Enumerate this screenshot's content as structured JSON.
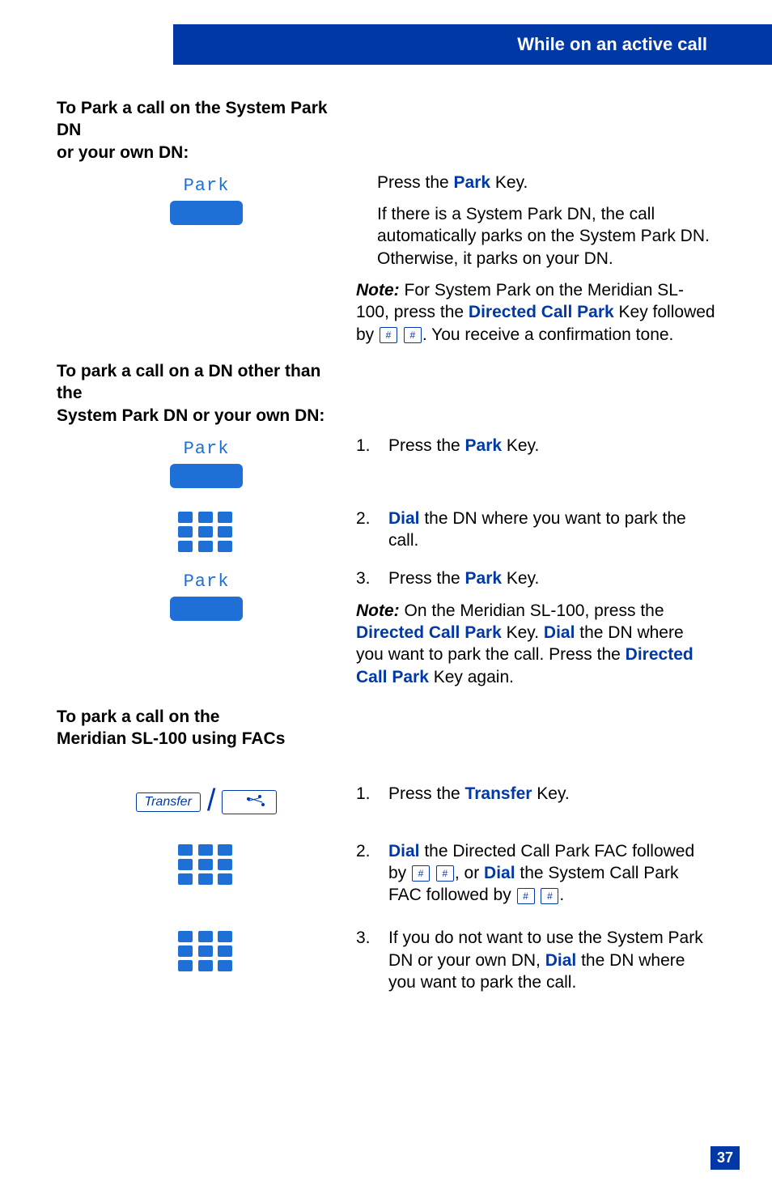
{
  "header": {
    "title": "While on an active call"
  },
  "section1": {
    "heading_line1": "To Park a call on the System Park DN",
    "heading_line2": "or your own DN:",
    "softkey_label": "Park",
    "para1_a": "Press the ",
    "para1_key": "Park",
    "para1_b": " Key.",
    "para2": "If there is a System Park DN, the call automatically parks on the System Park DN. Otherwise, it parks on your DN.",
    "note_label": "Note:",
    "note_a": " For System Park on the Meridian SL-100, press the ",
    "note_key": "Directed Call Park",
    "note_b": " Key followed by ",
    "note_c": ". You receive a confirmation tone."
  },
  "section2": {
    "heading_line1": "To park a call on a DN other than the",
    "heading_line2": "System Park DN or your own DN:",
    "softkey1_label": "Park",
    "softkey2_label": "Park",
    "step1_num": "1.",
    "step1_a": "Press the ",
    "step1_key": "Park",
    "step1_b": " Key.",
    "step2_num": "2.",
    "step2_key": "Dial",
    "step2_b": " the DN where you want to park the call.",
    "step3_num": "3.",
    "step3_a": "Press the ",
    "step3_key": "Park",
    "step3_b": " Key.",
    "note_label": "Note:",
    "note_a": " On the Meridian SL-100, press the ",
    "note_key1": "Directed Call Park",
    "note_b": " Key. ",
    "note_key2": "Dial",
    "note_c": " the DN where you want to park the call. Press the ",
    "note_key3": "Directed Call Park",
    "note_d": " Key again."
  },
  "section3": {
    "heading_line1": "To park a call on the",
    "heading_line2": "Meridian SL-100 using FACs",
    "transfer_label": "Transfer",
    "step1_num": "1.",
    "step1_a": "Press the ",
    "step1_key": "Transfer",
    "step1_b": " Key.",
    "step2_num": "2.",
    "step2_key1": "Dial",
    "step2_a": " the Directed Call Park FAC followed by ",
    "step2_b": ", or ",
    "step2_key2": "Dial",
    "step2_c": " the System Call Park FAC followed by ",
    "step2_d": ".",
    "step3_num": "3.",
    "step3_a": "If you do not want to use the System Park DN or your own DN, ",
    "step3_key": "Dial",
    "step3_b": " the DN where you want to park the call."
  },
  "page_number": "37",
  "hash_symbol": "#"
}
